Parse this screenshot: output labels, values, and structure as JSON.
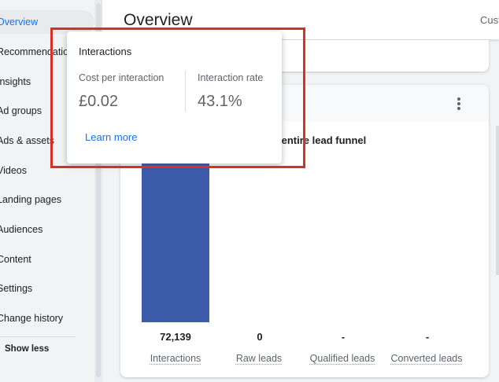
{
  "sidebar": {
    "items": [
      {
        "label": "Overview",
        "active": true
      },
      {
        "label": "Recommendations",
        "active": false
      },
      {
        "label": "Insights",
        "active": false
      },
      {
        "label": "Ad groups",
        "active": false
      },
      {
        "label": "Ads & assets",
        "active": false
      },
      {
        "label": "Videos",
        "active": false
      },
      {
        "label": "Landing pages",
        "active": false
      },
      {
        "label": "Audiences",
        "active": false
      },
      {
        "label": "Content",
        "active": false
      },
      {
        "label": "Settings",
        "active": false
      },
      {
        "label": "Change history",
        "active": false
      }
    ],
    "show_less": "Show less"
  },
  "header": {
    "title": "Overview",
    "right_text": "Cust"
  },
  "funnel_card": {
    "title_fragment": "ur entire lead funnel",
    "columns": [
      {
        "value": "72,139",
        "label": "Interactions"
      },
      {
        "value": "0",
        "label": "Raw leads"
      },
      {
        "value": "-",
        "label": "Qualified leads"
      },
      {
        "value": "-",
        "label": "Converted leads"
      }
    ]
  },
  "chart_data": {
    "type": "bar",
    "categories": [
      "Interactions",
      "Raw leads",
      "Qualified leads",
      "Converted leads"
    ],
    "values": [
      72139,
      0,
      null,
      null
    ]
  },
  "tooltip": {
    "title": "Interactions",
    "metrics": [
      {
        "label": "Cost per interaction",
        "value": "£0.02"
      },
      {
        "label": "Interaction rate",
        "value": "43.1%"
      }
    ],
    "link": "Learn more"
  },
  "colors": {
    "accent": "#1a73e8",
    "bar": "#3c5ba9",
    "highlight": "#d93025"
  }
}
